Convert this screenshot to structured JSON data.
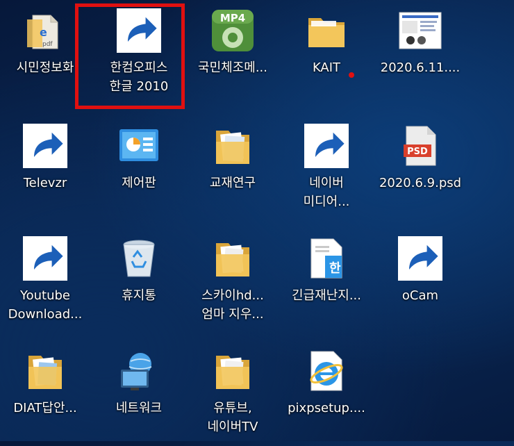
{
  "desktop": {
    "icons": [
      {
        "label1": "시민정보화",
        "label2": "",
        "icon": "pdf-file-icon"
      },
      {
        "label1": "한컴오피스",
        "label2": "한글 2010",
        "icon": "hwp-2010-icon",
        "shortcut": true,
        "selected": true
      },
      {
        "label1": "국민체조메...",
        "label2": "",
        "icon": "mp4-player-icon",
        "badge": "MP4"
      },
      {
        "label1": "KAIT",
        "label2": "",
        "icon": "folder-icon"
      },
      {
        "label1": "2020.6.11....",
        "label2": "",
        "icon": "screenshot-thumbnail-icon"
      },
      {
        "label1": "Televzr",
        "label2": "",
        "icon": "televzr-icon",
        "shortcut": true
      },
      {
        "label1": "제어판",
        "label2": "",
        "icon": "control-panel-icon"
      },
      {
        "label1": "교재연구",
        "label2": "",
        "icon": "folder-icon"
      },
      {
        "label1": "네이버",
        "label2": "미디어...",
        "icon": "naver-media-player-icon",
        "shortcut": true
      },
      {
        "label1": "2020.6.9.psd",
        "label2": "",
        "icon": "psd-file-icon",
        "badge": "PSD"
      },
      {
        "label1": "Youtube",
        "label2": "Download...",
        "icon": "youtube-downloader-icon",
        "shortcut": true
      },
      {
        "label1": "휴지통",
        "label2": "",
        "icon": "recycle-bin-icon"
      },
      {
        "label1": "스카이hd...",
        "label2": "엄마 지우...",
        "icon": "folder-icon"
      },
      {
        "label1": "긴급재난지...",
        "label2": "",
        "icon": "hwp-document-icon"
      },
      {
        "label1": "oCam",
        "label2": "",
        "icon": "ocam-icon",
        "shortcut": true
      },
      {
        "label1": "DIAT답안...",
        "label2": "",
        "icon": "folder-icon"
      },
      {
        "label1": "네트워크",
        "label2": "",
        "icon": "network-icon"
      },
      {
        "label1": "유튜브,",
        "label2": "네이버TV",
        "icon": "folder-icon"
      },
      {
        "label1": "pixpsetup....",
        "label2": "",
        "icon": "internet-explorer-icon"
      }
    ]
  },
  "colors": {
    "selection_outline": "#e01010",
    "folder": "#f3c65b",
    "background": "#0a2a58"
  }
}
